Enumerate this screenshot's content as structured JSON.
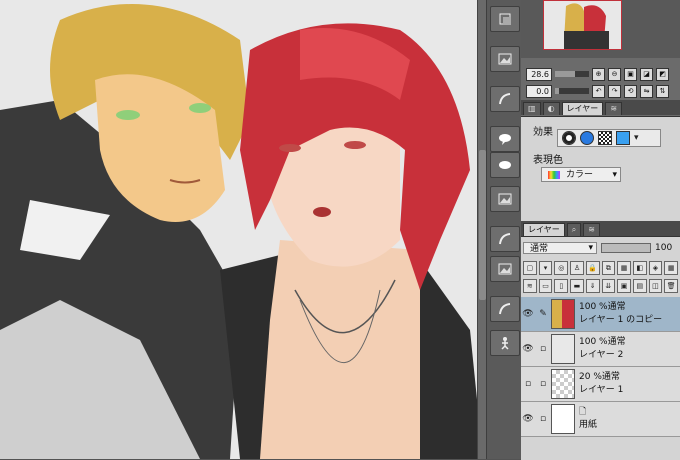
{
  "navigator": {
    "zoom_value": "28.6",
    "rotate_value": "0.0"
  },
  "upper_tabs": {
    "layer_tab": "レイヤー"
  },
  "properties": {
    "effect_label": "効果",
    "expression_color_label": "表現色",
    "expression_color_value": "カラー"
  },
  "layer_tabs": {
    "layer_tab": "レイヤー"
  },
  "layer_panel": {
    "blend_mode": "通常",
    "opacity": "100",
    "layers": [
      {
        "blend": "100 %通常",
        "name": "レイヤー 1 のコピー",
        "selected": true,
        "visible": true,
        "thumb": "art"
      },
      {
        "blend": "100 %通常",
        "name": "レイヤー 2",
        "selected": false,
        "visible": true,
        "thumb": "grey"
      },
      {
        "blend": "20 %通常",
        "name": "レイヤー 1",
        "selected": false,
        "visible": false,
        "thumb": "check"
      },
      {
        "blend": "",
        "name": "用紙",
        "selected": false,
        "visible": true,
        "thumb": "paper"
      }
    ]
  },
  "colors": {
    "canvas_bg": "#e8e8e8",
    "panel_bg": "#d4d4d4",
    "selected_layer": "#9fb6c9",
    "nav_frame": "#c0303a"
  }
}
